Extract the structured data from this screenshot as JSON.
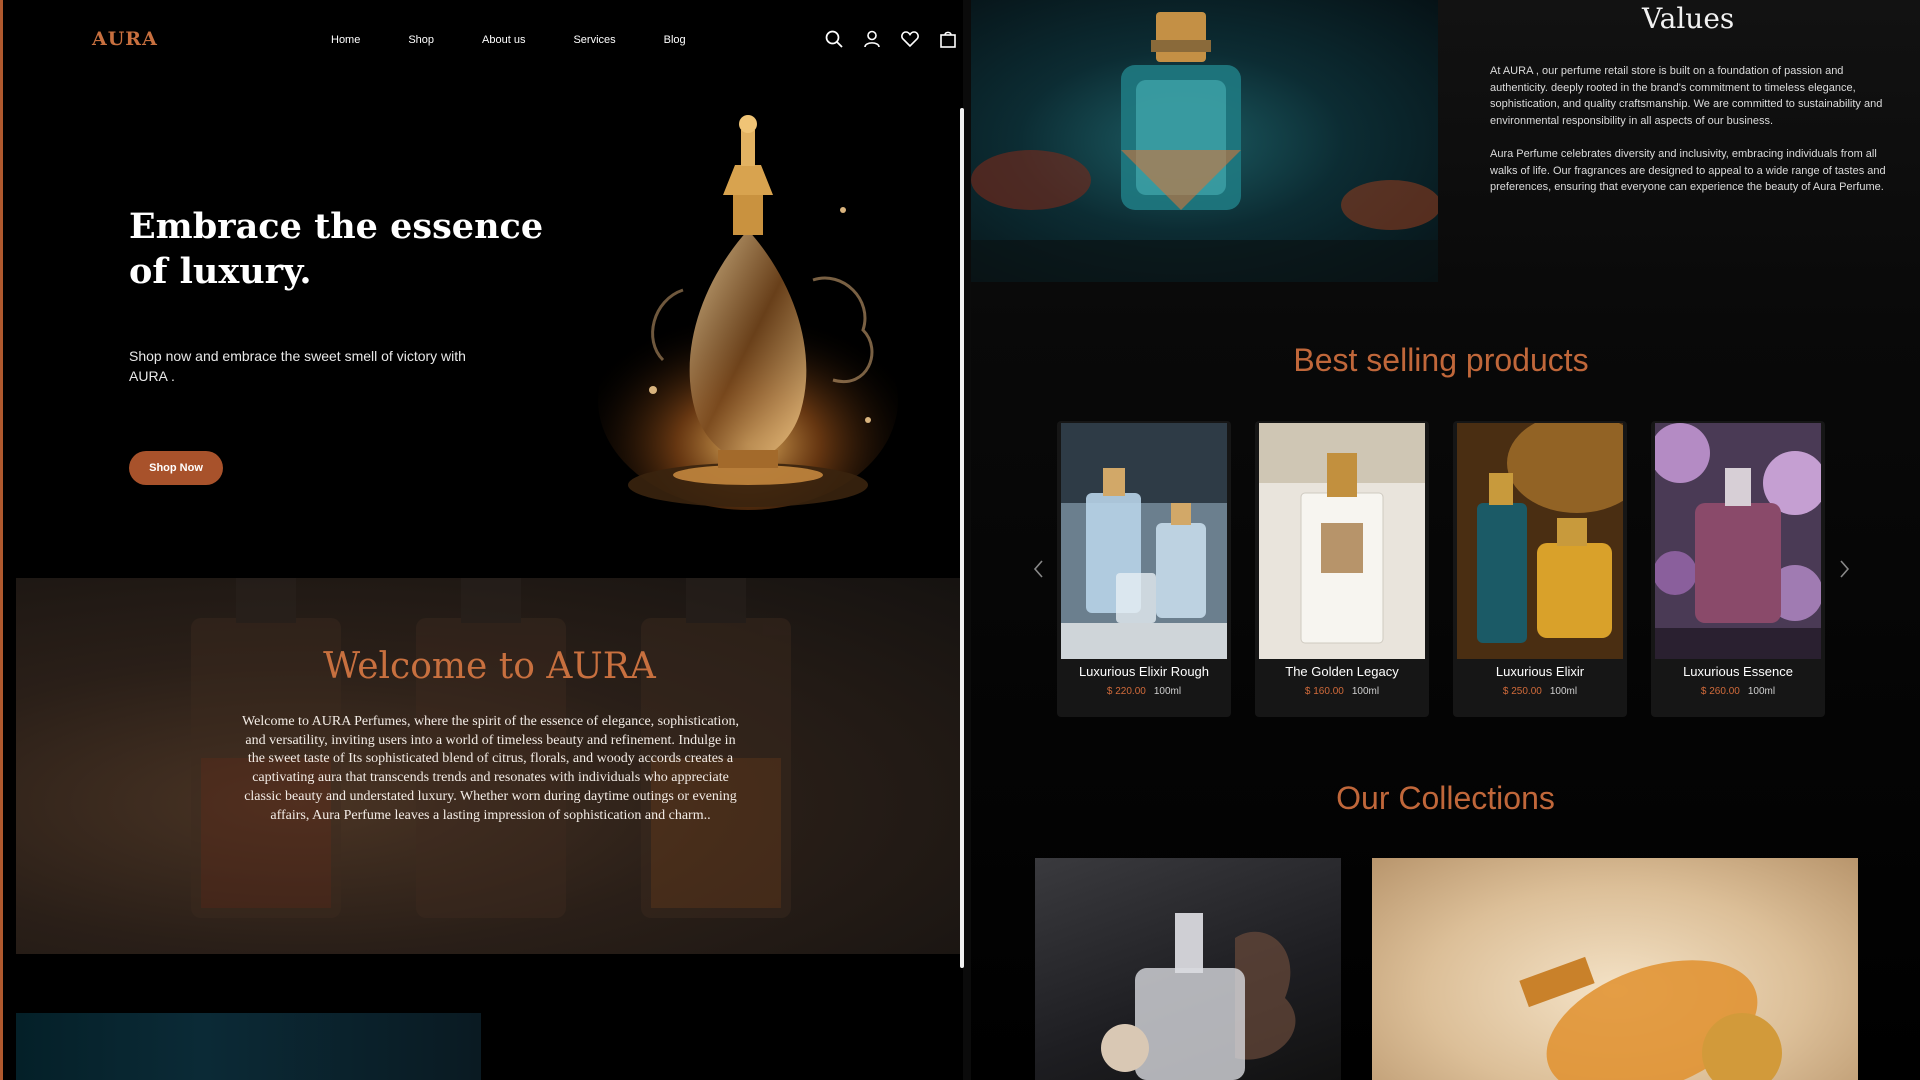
{
  "brand": {
    "logo": "AURA"
  },
  "nav": {
    "links": [
      "Home",
      "Shop",
      "About us",
      "Services",
      "Blog"
    ],
    "icons": [
      "search-icon",
      "user-icon",
      "heart-icon",
      "bag-icon"
    ]
  },
  "hero": {
    "title": "Embrace the essence of luxury.",
    "subtitle": "Shop now and embrace the sweet smell of victory with AURA .",
    "cta": "Shop Now"
  },
  "welcome": {
    "title": "Welcome to AURA",
    "text": "Welcome to AURA  Perfumes, where the spirit of the essence of elegance, sophistication, and versatility, inviting users into a world of timeless beauty and refinement. Indulge in the sweet taste of Its sophisticated blend of citrus, florals, and woody accords creates a captivating aura that transcends trends and resonates with individuals who appreciate classic beauty and understated luxury. Whether worn during daytime outings or evening affairs, Aura Perfume leaves a lasting impression of sophistication and charm.."
  },
  "values": {
    "title": "Values",
    "paragraphs": [
      " At AURA , our perfume retail store is built on a foundation of passion and authenticity. deeply rooted in the brand's commitment to timeless elegance, sophistication, and quality craftsmanship. We are committed to sustainability and environmental responsibility in all aspects of our business.",
      "Aura Perfume celebrates diversity and inclusivity, embracing individuals from all walks of life. Our fragrances are designed to appeal to a wide range of tastes and preferences, ensuring that everyone can experience the beauty of Aura Perfume."
    ]
  },
  "best_selling": {
    "title": "Best selling products",
    "products": [
      {
        "name": "Luxurious Elixir Rough",
        "price": "$ 220.00",
        "size": "100ml"
      },
      {
        "name": "The Golden Legacy",
        "price": "$ 160.00",
        "size": "100ml"
      },
      {
        "name": "Luxurious Elixir",
        "price": "$ 250.00",
        "size": "100ml"
      },
      {
        "name": "Luxurious Essence",
        "price": "$ 260.00",
        "size": "100ml"
      }
    ]
  },
  "collections": {
    "title": "Our Collections"
  },
  "colors": {
    "accent": "#c0673a",
    "button": "#a8522b",
    "background": "#000000"
  }
}
